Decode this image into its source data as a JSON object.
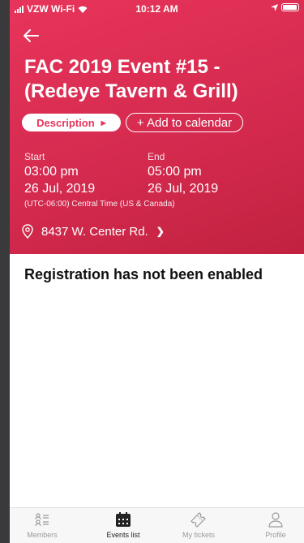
{
  "status_bar": {
    "carrier": "VZW Wi-Fi",
    "time": "10:12 AM"
  },
  "event": {
    "title": "FAC 2019 Event #15 - (Redeye Tavern & Grill)",
    "description_button": "Description",
    "add_calendar_button": "+ Add to calendar",
    "start_label": "Start",
    "start_time": "03:00 pm",
    "start_date": "26 Jul, 2019",
    "end_label": "End",
    "end_time": "05:00 pm",
    "end_date": "26 Jul, 2019",
    "timezone": "(UTC-06:00) Central Time (US & Canada)",
    "location": "8437 W. Center Rd."
  },
  "registration_notice": "Registration has not been enabled",
  "tabs": [
    {
      "label": "Members",
      "icon": "members-icon",
      "active": false
    },
    {
      "label": "Events list",
      "icon": "calendar-icon",
      "active": true
    },
    {
      "label": "My tickets",
      "icon": "ticket-icon",
      "active": false
    },
    {
      "label": "Profile",
      "icon": "profile-icon",
      "active": false
    }
  ],
  "colors": {
    "accent": "#e8345a",
    "hero_dark": "#c1223f"
  }
}
